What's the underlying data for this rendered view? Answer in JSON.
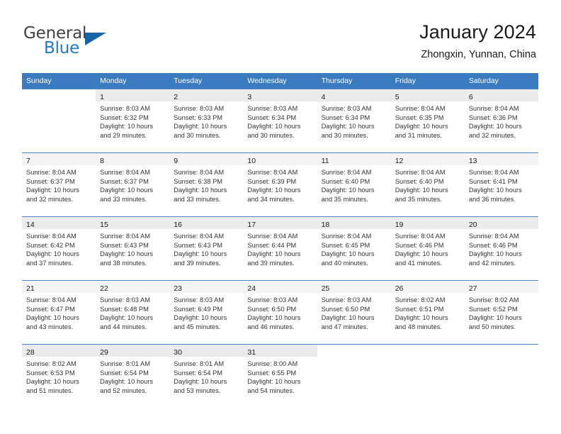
{
  "brand": {
    "name_part1": "General",
    "name_part2": "Blue",
    "logo_icon": "triangle-logo-icon",
    "accent_color": "#1f78c1"
  },
  "header": {
    "title": "January 2024",
    "subtitle": "Zhongxin, Yunnan, China"
  },
  "calendar": {
    "header_bg": "#3a7cbf",
    "grid_line_color": "#4a86c5",
    "weekday_headers": [
      "Sunday",
      "Monday",
      "Tuesday",
      "Wednesday",
      "Thursday",
      "Friday",
      "Saturday"
    ],
    "weeks": [
      [
        {
          "day": "",
          "lines": []
        },
        {
          "day": "1",
          "lines": [
            "Sunrise: 8:03 AM",
            "Sunset: 6:32 PM",
            "Daylight: 10 hours",
            "and 29 minutes."
          ]
        },
        {
          "day": "2",
          "lines": [
            "Sunrise: 8:03 AM",
            "Sunset: 6:33 PM",
            "Daylight: 10 hours",
            "and 30 minutes."
          ]
        },
        {
          "day": "3",
          "lines": [
            "Sunrise: 8:03 AM",
            "Sunset: 6:34 PM",
            "Daylight: 10 hours",
            "and 30 minutes."
          ]
        },
        {
          "day": "4",
          "lines": [
            "Sunrise: 8:03 AM",
            "Sunset: 6:34 PM",
            "Daylight: 10 hours",
            "and 30 minutes."
          ]
        },
        {
          "day": "5",
          "lines": [
            "Sunrise: 8:04 AM",
            "Sunset: 6:35 PM",
            "Daylight: 10 hours",
            "and 31 minutes."
          ]
        },
        {
          "day": "6",
          "lines": [
            "Sunrise: 8:04 AM",
            "Sunset: 6:36 PM",
            "Daylight: 10 hours",
            "and 32 minutes."
          ]
        }
      ],
      [
        {
          "day": "7",
          "lines": [
            "Sunrise: 8:04 AM",
            "Sunset: 6:37 PM",
            "Daylight: 10 hours",
            "and 32 minutes."
          ]
        },
        {
          "day": "8",
          "lines": [
            "Sunrise: 8:04 AM",
            "Sunset: 6:37 PM",
            "Daylight: 10 hours",
            "and 33 minutes."
          ]
        },
        {
          "day": "9",
          "lines": [
            "Sunrise: 8:04 AM",
            "Sunset: 6:38 PM",
            "Daylight: 10 hours",
            "and 33 minutes."
          ]
        },
        {
          "day": "10",
          "lines": [
            "Sunrise: 8:04 AM",
            "Sunset: 6:39 PM",
            "Daylight: 10 hours",
            "and 34 minutes."
          ]
        },
        {
          "day": "11",
          "lines": [
            "Sunrise: 8:04 AM",
            "Sunset: 6:40 PM",
            "Daylight: 10 hours",
            "and 35 minutes."
          ]
        },
        {
          "day": "12",
          "lines": [
            "Sunrise: 8:04 AM",
            "Sunset: 6:40 PM",
            "Daylight: 10 hours",
            "and 35 minutes."
          ]
        },
        {
          "day": "13",
          "lines": [
            "Sunrise: 8:04 AM",
            "Sunset: 6:41 PM",
            "Daylight: 10 hours",
            "and 36 minutes."
          ]
        }
      ],
      [
        {
          "day": "14",
          "lines": [
            "Sunrise: 8:04 AM",
            "Sunset: 6:42 PM",
            "Daylight: 10 hours",
            "and 37 minutes."
          ]
        },
        {
          "day": "15",
          "lines": [
            "Sunrise: 8:04 AM",
            "Sunset: 6:43 PM",
            "Daylight: 10 hours",
            "and 38 minutes."
          ]
        },
        {
          "day": "16",
          "lines": [
            "Sunrise: 8:04 AM",
            "Sunset: 6:43 PM",
            "Daylight: 10 hours",
            "and 39 minutes."
          ]
        },
        {
          "day": "17",
          "lines": [
            "Sunrise: 8:04 AM",
            "Sunset: 6:44 PM",
            "Daylight: 10 hours",
            "and 39 minutes."
          ]
        },
        {
          "day": "18",
          "lines": [
            "Sunrise: 8:04 AM",
            "Sunset: 6:45 PM",
            "Daylight: 10 hours",
            "and 40 minutes."
          ]
        },
        {
          "day": "19",
          "lines": [
            "Sunrise: 8:04 AM",
            "Sunset: 6:46 PM",
            "Daylight: 10 hours",
            "and 41 minutes."
          ]
        },
        {
          "day": "20",
          "lines": [
            "Sunrise: 8:04 AM",
            "Sunset: 6:46 PM",
            "Daylight: 10 hours",
            "and 42 minutes."
          ]
        }
      ],
      [
        {
          "day": "21",
          "lines": [
            "Sunrise: 8:04 AM",
            "Sunset: 6:47 PM",
            "Daylight: 10 hours",
            "and 43 minutes."
          ]
        },
        {
          "day": "22",
          "lines": [
            "Sunrise: 8:03 AM",
            "Sunset: 6:48 PM",
            "Daylight: 10 hours",
            "and 44 minutes."
          ]
        },
        {
          "day": "23",
          "lines": [
            "Sunrise: 8:03 AM",
            "Sunset: 6:49 PM",
            "Daylight: 10 hours",
            "and 45 minutes."
          ]
        },
        {
          "day": "24",
          "lines": [
            "Sunrise: 8:03 AM",
            "Sunset: 6:50 PM",
            "Daylight: 10 hours",
            "and 46 minutes."
          ]
        },
        {
          "day": "25",
          "lines": [
            "Sunrise: 8:03 AM",
            "Sunset: 6:50 PM",
            "Daylight: 10 hours",
            "and 47 minutes."
          ]
        },
        {
          "day": "26",
          "lines": [
            "Sunrise: 8:02 AM",
            "Sunset: 6:51 PM",
            "Daylight: 10 hours",
            "and 48 minutes."
          ]
        },
        {
          "day": "27",
          "lines": [
            "Sunrise: 8:02 AM",
            "Sunset: 6:52 PM",
            "Daylight: 10 hours",
            "and 50 minutes."
          ]
        }
      ],
      [
        {
          "day": "28",
          "lines": [
            "Sunrise: 8:02 AM",
            "Sunset: 6:53 PM",
            "Daylight: 10 hours",
            "and 51 minutes."
          ]
        },
        {
          "day": "29",
          "lines": [
            "Sunrise: 8:01 AM",
            "Sunset: 6:54 PM",
            "Daylight: 10 hours",
            "and 52 minutes."
          ]
        },
        {
          "day": "30",
          "lines": [
            "Sunrise: 8:01 AM",
            "Sunset: 6:54 PM",
            "Daylight: 10 hours",
            "and 53 minutes."
          ]
        },
        {
          "day": "31",
          "lines": [
            "Sunrise: 8:00 AM",
            "Sunset: 6:55 PM",
            "Daylight: 10 hours",
            "and 54 minutes."
          ]
        },
        {
          "day": "",
          "lines": []
        },
        {
          "day": "",
          "lines": []
        },
        {
          "day": "",
          "lines": []
        }
      ]
    ]
  }
}
